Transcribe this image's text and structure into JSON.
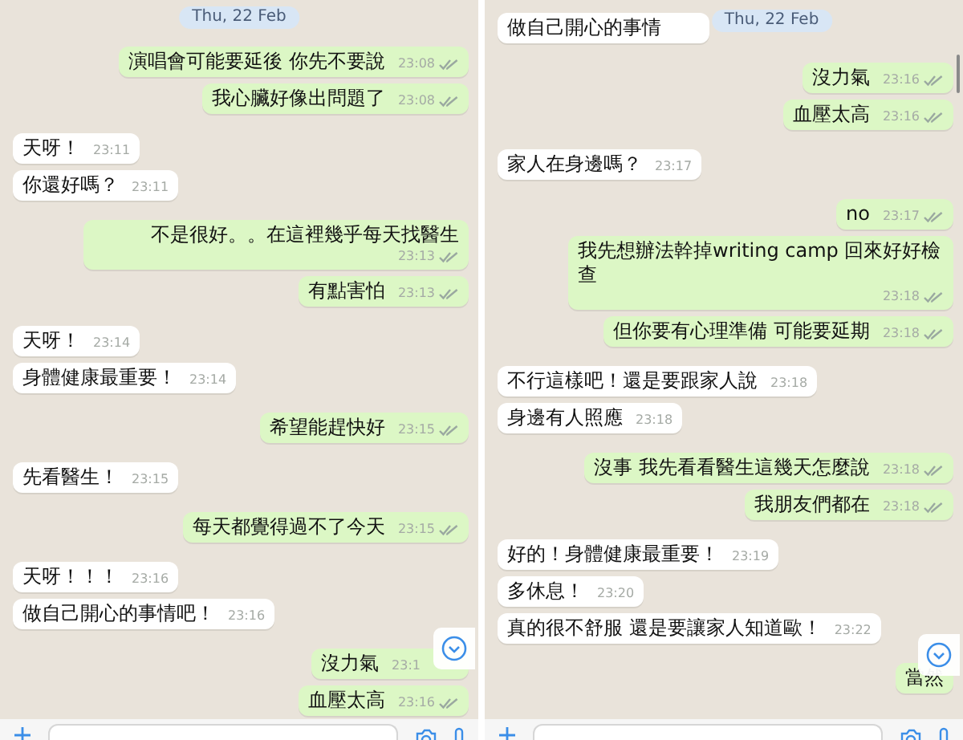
{
  "panels": [
    {
      "date_label": "Thu, 22 Feb",
      "messages": [
        {
          "kind": "out",
          "text": "演唱會可能要延後 你先不要說",
          "time": "23:08",
          "ticks": true
        },
        {
          "kind": "out",
          "text": "我心臟好像出問題了",
          "time": "23:08",
          "ticks": true
        },
        {
          "kind": "in",
          "text": "天呀！",
          "time": "23:11"
        },
        {
          "kind": "in",
          "text": "你還好嗎？",
          "time": "23:11"
        },
        {
          "kind": "out",
          "text": "不是很好。。在這裡幾乎每天找醫生",
          "time": "23:13",
          "ticks": true
        },
        {
          "kind": "out",
          "text": "有點害怕",
          "time": "23:13",
          "ticks": true
        },
        {
          "kind": "in",
          "text": "天呀！",
          "time": "23:14"
        },
        {
          "kind": "in",
          "text": "身體健康最重要！",
          "time": "23:14"
        },
        {
          "kind": "out",
          "text": "希望能趕快好",
          "time": "23:15",
          "ticks": true
        },
        {
          "kind": "in",
          "text": "先看醫生！",
          "time": "23:15"
        },
        {
          "kind": "out",
          "text": "每天都覺得過不了今天",
          "time": "23:15",
          "ticks": true
        },
        {
          "kind": "in",
          "text": "天呀！！！",
          "time": "23:16"
        },
        {
          "kind": "in",
          "text": "做自己開心的事情吧！",
          "time": "23:16"
        },
        {
          "kind": "out",
          "text": "沒力氣",
          "time": "23:1",
          "covered": true
        },
        {
          "kind": "out",
          "text": "血壓太高",
          "time": "23:16",
          "ticks": true
        }
      ]
    },
    {
      "date_label": "Thu, 22 Feb",
      "scrollbar": true,
      "messages": [
        {
          "kind": "in",
          "text": "做自己開心的事情",
          "covered": true
        },
        {
          "kind": "out",
          "text": "沒力氣",
          "time": "23:16",
          "ticks": true
        },
        {
          "kind": "out",
          "text": "血壓太高",
          "time": "23:16",
          "ticks": true
        },
        {
          "kind": "in",
          "text": "家人在身邊嗎？",
          "time": "23:17"
        },
        {
          "kind": "out",
          "text": "no",
          "time": "23:17",
          "ticks": true
        },
        {
          "kind": "out",
          "text": "我先想辦法幹掉writing camp 回來好好檢查",
          "time": "23:18",
          "ticks": true
        },
        {
          "kind": "out",
          "text": "但你要有心理準備 可能要延期",
          "time": "23:18",
          "ticks": true
        },
        {
          "kind": "in",
          "text": "不行這樣吧！還是要跟家人說",
          "time": "23:18"
        },
        {
          "kind": "in",
          "text": "身邊有人照應",
          "time": "23:18"
        },
        {
          "kind": "out",
          "text": "沒事 我先看看醫生這幾天怎麼說",
          "time": "23:18",
          "ticks": true
        },
        {
          "kind": "out",
          "text": "我朋友們都在",
          "time": "23:18",
          "ticks": true
        },
        {
          "kind": "in",
          "text": "好的！身體健康最重要！",
          "time": "23:19"
        },
        {
          "kind": "in",
          "text": "多休息！",
          "time": "23:20"
        },
        {
          "kind": "in",
          "text": "真的很不舒服 還是要讓家人知道歐！",
          "time": "23:22"
        },
        {
          "kind": "out",
          "text": "當然"
        }
      ]
    }
  ]
}
